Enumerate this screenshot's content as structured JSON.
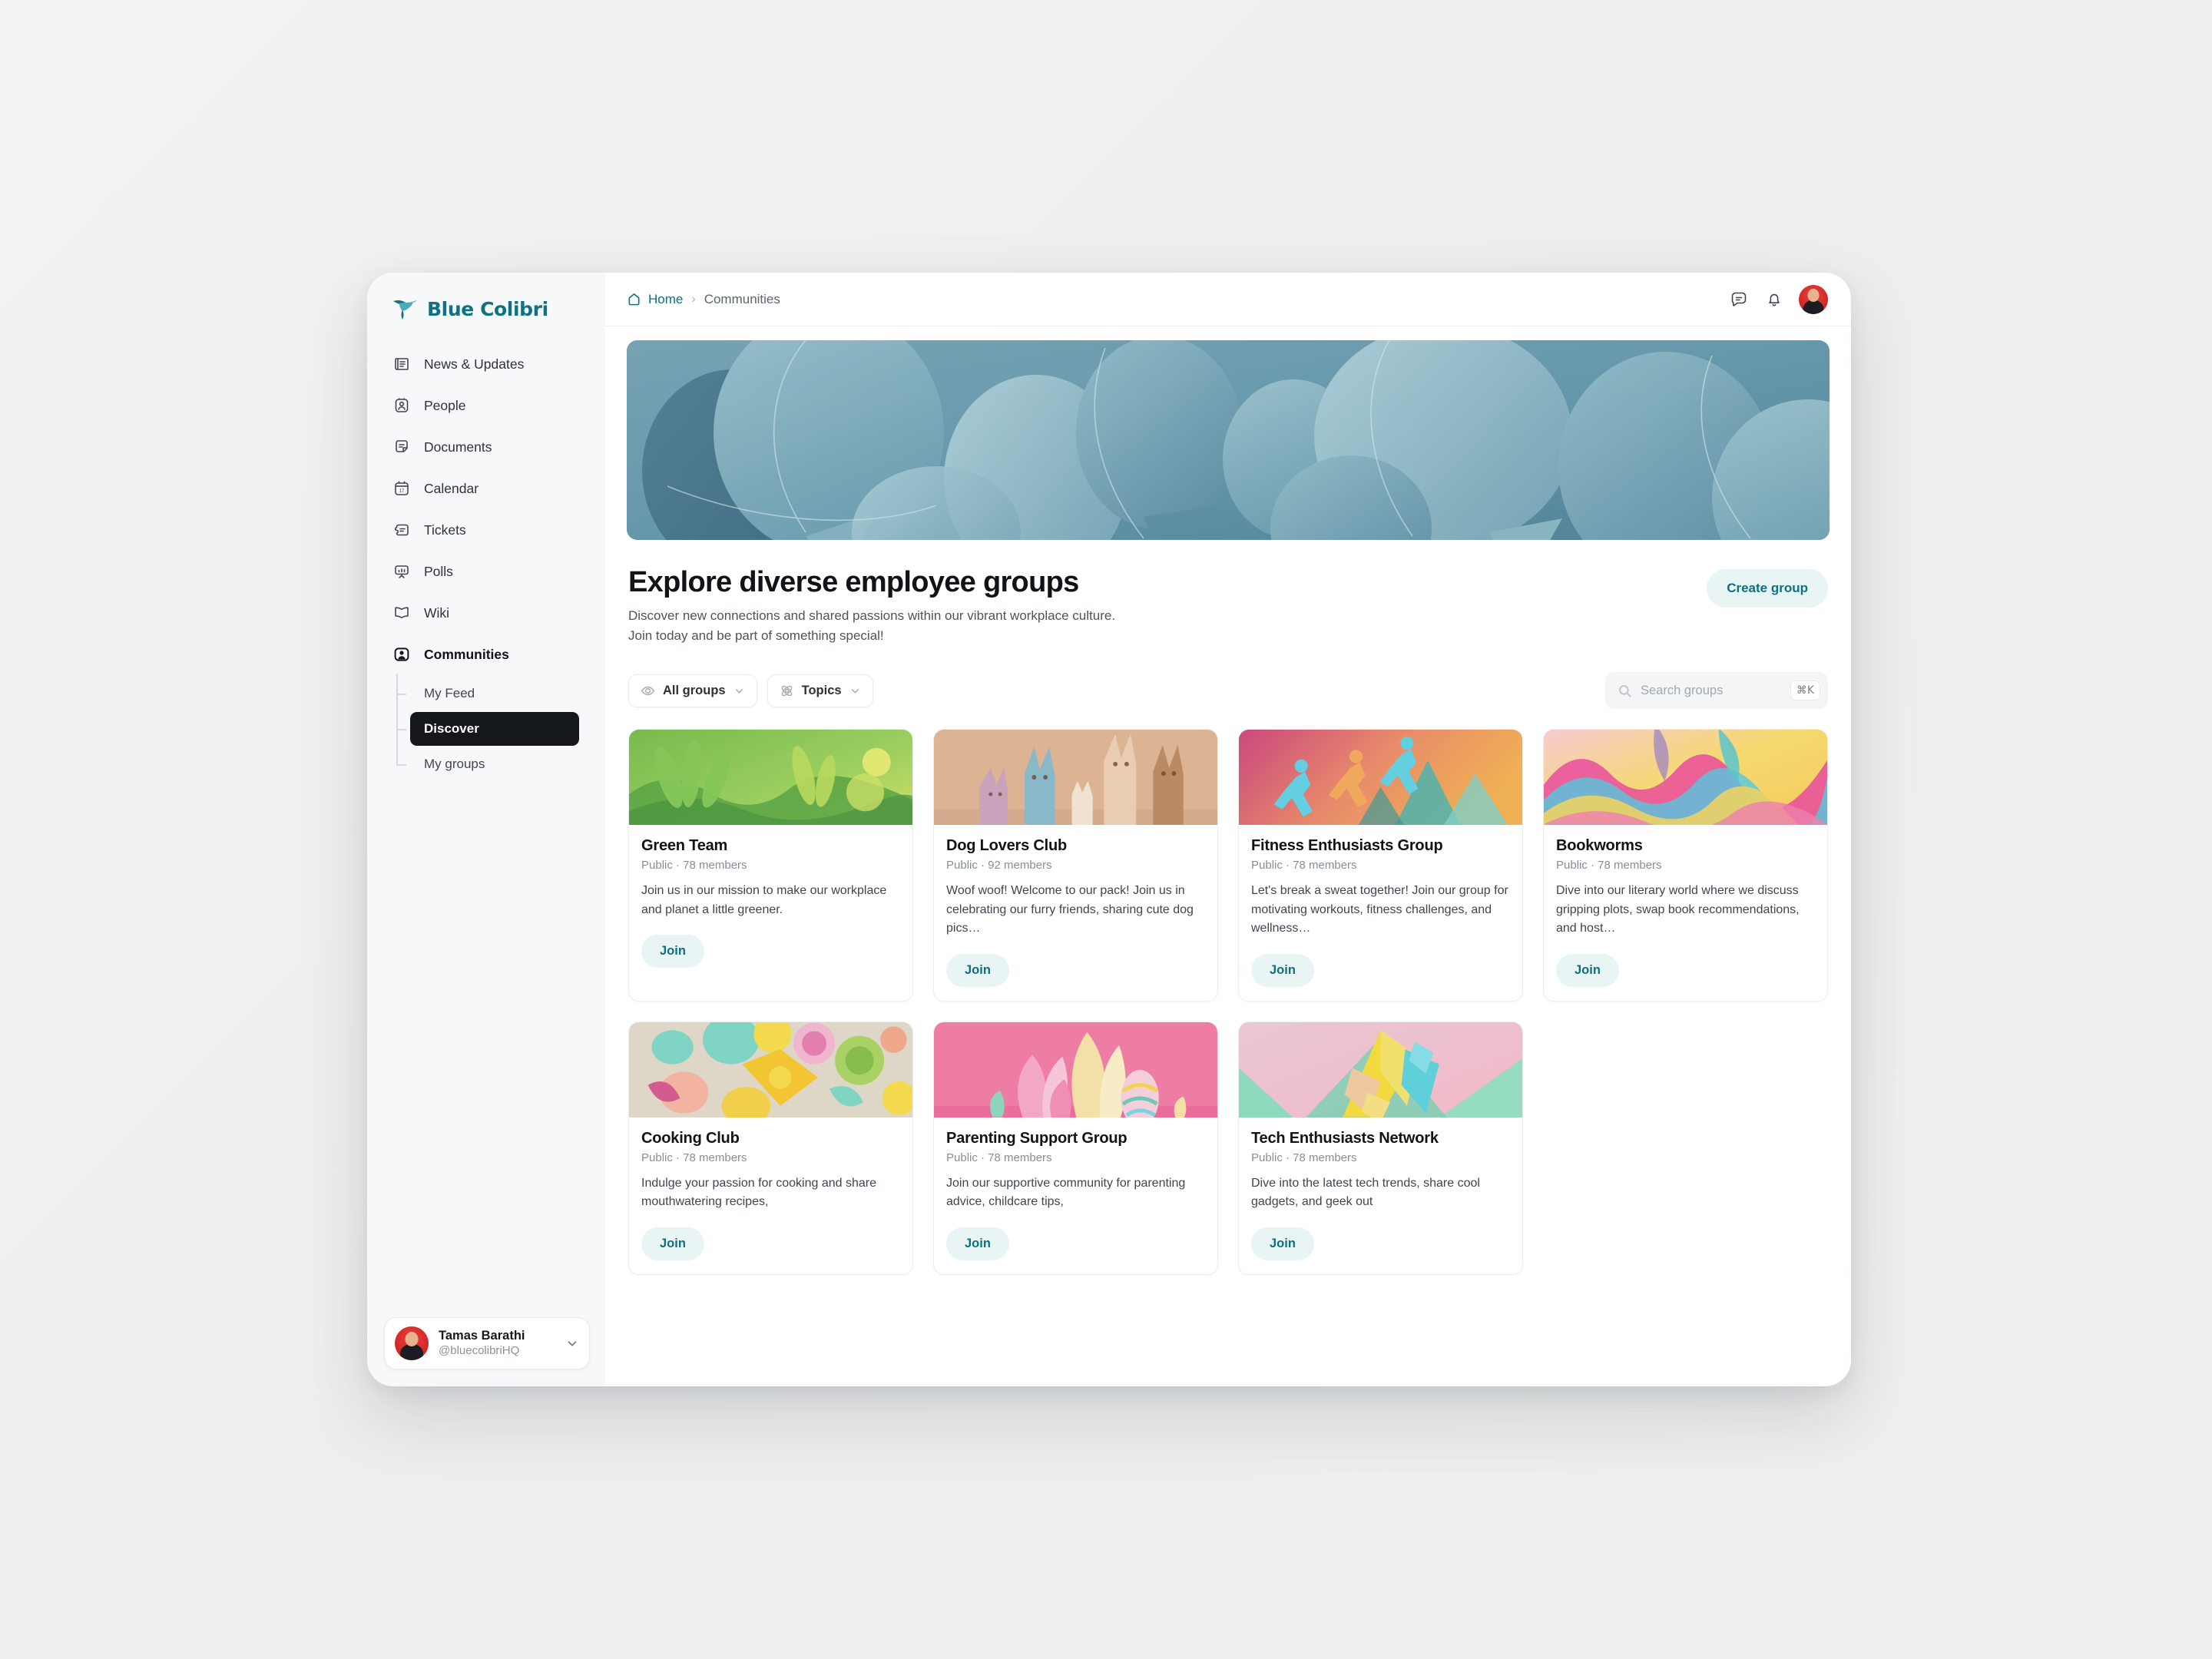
{
  "brand": {
    "name": "Blue Colibri",
    "accent": "#0f7183"
  },
  "sidebar": {
    "items": [
      {
        "label": "News & Updates",
        "icon": "newspaper-icon"
      },
      {
        "label": "People",
        "icon": "id-card-icon"
      },
      {
        "label": "Documents",
        "icon": "document-icon"
      },
      {
        "label": "Calendar",
        "icon": "calendar-icon"
      },
      {
        "label": "Tickets",
        "icon": "ticket-icon"
      },
      {
        "label": "Polls",
        "icon": "poll-chart-icon"
      },
      {
        "label": "Wiki",
        "icon": "book-icon"
      },
      {
        "label": "Communities",
        "icon": "community-icon"
      }
    ],
    "subitems": [
      {
        "label": "My Feed",
        "active": false
      },
      {
        "label": "Discover",
        "active": true
      },
      {
        "label": "My groups",
        "active": false
      }
    ],
    "user": {
      "name": "Tamas Barathi",
      "handle": "@bluecolibriHQ"
    }
  },
  "topbar": {
    "breadcrumb": {
      "home": "Home",
      "separator": "›",
      "current": "Communities"
    },
    "icons": [
      "chat-bubble-icon",
      "bell-icon",
      "avatar"
    ]
  },
  "header": {
    "title": "Explore diverse employee groups",
    "subtitle": "Discover new connections and shared passions within our vibrant workplace culture. Join today and be part of something special!",
    "create_button": "Create group"
  },
  "filters": {
    "all_groups": "All groups",
    "topics": "Topics",
    "search_placeholder": "Search groups",
    "search_value": "",
    "shortcut": "⌘K"
  },
  "cards": [
    {
      "title": "Green Team",
      "meta": "Public · 78 members",
      "description": "Join us in our mission to make our workplace and planet a little greener.",
      "join": "Join",
      "thumb": "green-leaves-papercraft"
    },
    {
      "title": "Dog Lovers Club",
      "meta": "Public · 92 members",
      "description": "Woof woof! Welcome to our pack! Join us in celebrating our furry friends, sharing cute dog pics…",
      "join": "Join",
      "thumb": "dogs-papercraft"
    },
    {
      "title": "Fitness Enthusiasts Group",
      "meta": "Public · 78 members",
      "description": "Let's break a sweat together! Join our group for motivating workouts, fitness challenges, and wellness…",
      "join": "Join",
      "thumb": "runners-papercraft"
    },
    {
      "title": "Bookworms",
      "meta": "Public · 78 members",
      "description": "Dive into our literary world where we discuss gripping plots, swap book recommendations, and host…",
      "join": "Join",
      "thumb": "waves-papercraft"
    },
    {
      "title": "Cooking Club",
      "meta": "Public · 78 members",
      "description": "Indulge your passion for cooking and share mouthwatering recipes,",
      "join": "Join",
      "thumb": "pastel-shapes-papercraft"
    },
    {
      "title": "Parenting Support Group",
      "meta": "Public · 78 members",
      "description": "Join our supportive community for parenting advice, childcare tips,",
      "join": "Join",
      "thumb": "pink-flowers-papercraft"
    },
    {
      "title": "Tech Enthusiasts Network",
      "meta": "Public · 78 members",
      "description": "Dive into the latest tech trends, share cool gadgets, and geek out",
      "join": "Join",
      "thumb": "teal-yellow-papercraft"
    }
  ],
  "colors": {
    "accent_teal": "#10707f",
    "accent_bg": "#e9f4f4",
    "active_dark": "#14181c",
    "hero_blue": "#6d9cae"
  }
}
